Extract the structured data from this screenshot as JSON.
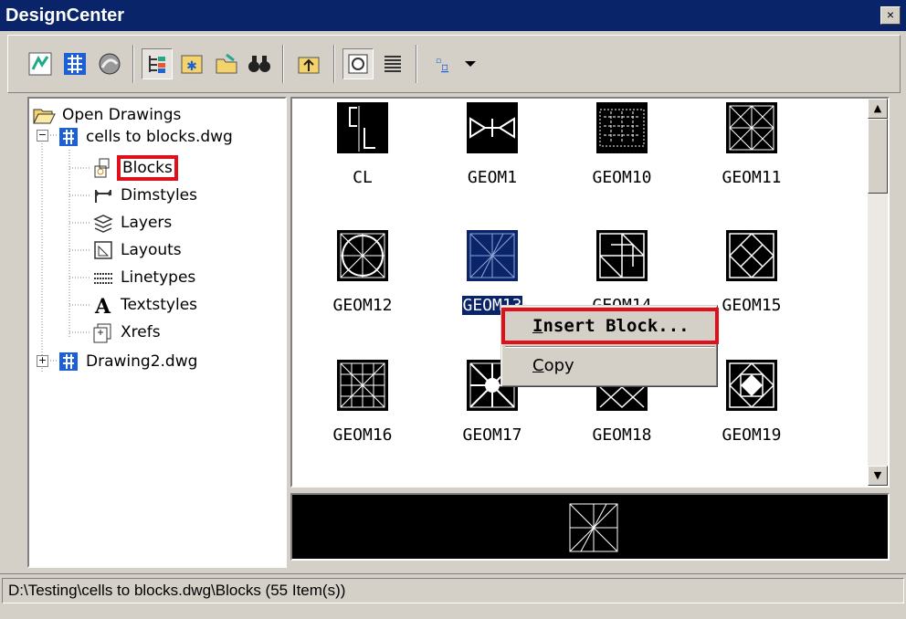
{
  "window": {
    "title": "DesignCenter",
    "close_glyph": "×"
  },
  "toolbar": {
    "buttons": [
      {
        "icon": "load-icon"
      },
      {
        "icon": "tree-view-icon"
      },
      {
        "icon": "online-icon"
      },
      {
        "icon": "tree-toggle-icon"
      },
      {
        "icon": "favorites-icon"
      },
      {
        "icon": "load-folder-icon"
      },
      {
        "icon": "search-binoculars-icon"
      },
      {
        "icon": "up-folder-icon"
      },
      {
        "icon": "preview-toggle-icon"
      },
      {
        "icon": "description-toggle-icon"
      },
      {
        "icon": "views-icon"
      }
    ]
  },
  "tree": {
    "open_drawings": "Open Drawings",
    "drawing1": "cells to blocks.dwg",
    "children": [
      "Blocks",
      "Dimstyles",
      "Layers",
      "Layouts",
      "Linetypes",
      "Textstyles",
      "Xrefs"
    ],
    "drawing2": "Drawing2.dwg",
    "expand_minus": "−",
    "expand_plus": "+"
  },
  "grid": {
    "items": [
      "CL",
      "GEOM1",
      "GEOM10",
      "GEOM11",
      "GEOM12",
      "GEOM13",
      "GEOM14",
      "GEOM15",
      "GEOM16",
      "GEOM17",
      "GEOM18",
      "GEOM19"
    ],
    "selected_index": 5
  },
  "context_menu": {
    "insert_block": {
      "hotkey": "I",
      "rest": "nsert Block..."
    },
    "copy": {
      "hotkey": "C",
      "rest": "opy"
    }
  },
  "status": {
    "path": "D:\\Testing\\cells to blocks.dwg\\Blocks (55 Item(s))"
  },
  "colors": {
    "title_bar": "#0a246a",
    "highlight_outline": "#e0101a",
    "face": "#d4d0c8"
  }
}
